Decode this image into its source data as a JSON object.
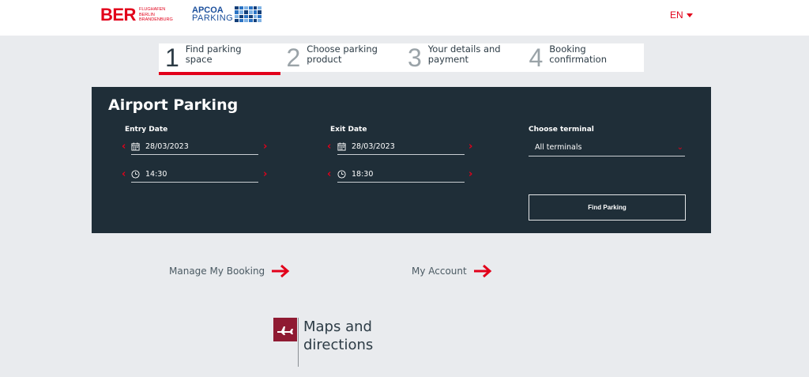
{
  "header": {
    "ber_logo": "BER",
    "ber_sub_lines": [
      "FLUGHAFEN",
      "BERLIN",
      "BRANDENBURG"
    ],
    "apcoa_logo": [
      "APCOA",
      "PARKING"
    ],
    "language": "EN"
  },
  "steps": [
    {
      "num": "1",
      "label_line1": "Find parking",
      "label_line2": "space",
      "active": true
    },
    {
      "num": "2",
      "label_line1": "Choose parking",
      "label_line2": "product",
      "active": false
    },
    {
      "num": "3",
      "label_line1": "Your details and",
      "label_line2": "payment",
      "active": false
    },
    {
      "num": "4",
      "label_line1": "Booking",
      "label_line2": "confirmation",
      "active": false
    }
  ],
  "panel": {
    "title": "Airport Parking",
    "entry": {
      "label": "Entry Date",
      "date": "28/03/2023",
      "time": "14:30"
    },
    "exit": {
      "label": "Exit Date",
      "date": "28/03/2023",
      "time": "18:30"
    },
    "terminal": {
      "label": "Choose terminal",
      "value": "All terminals"
    },
    "find_button": "Find Parking"
  },
  "links": {
    "manage_booking": "Manage My Booking",
    "my_account": "My Account"
  },
  "maps": {
    "line1": "Maps and",
    "line2": "directions"
  },
  "colors": {
    "accent": "#e2001a",
    "panel_bg": "#1f2e38",
    "page_bg": "#e9ebee",
    "maps_icon_bg": "#8f1a32"
  }
}
